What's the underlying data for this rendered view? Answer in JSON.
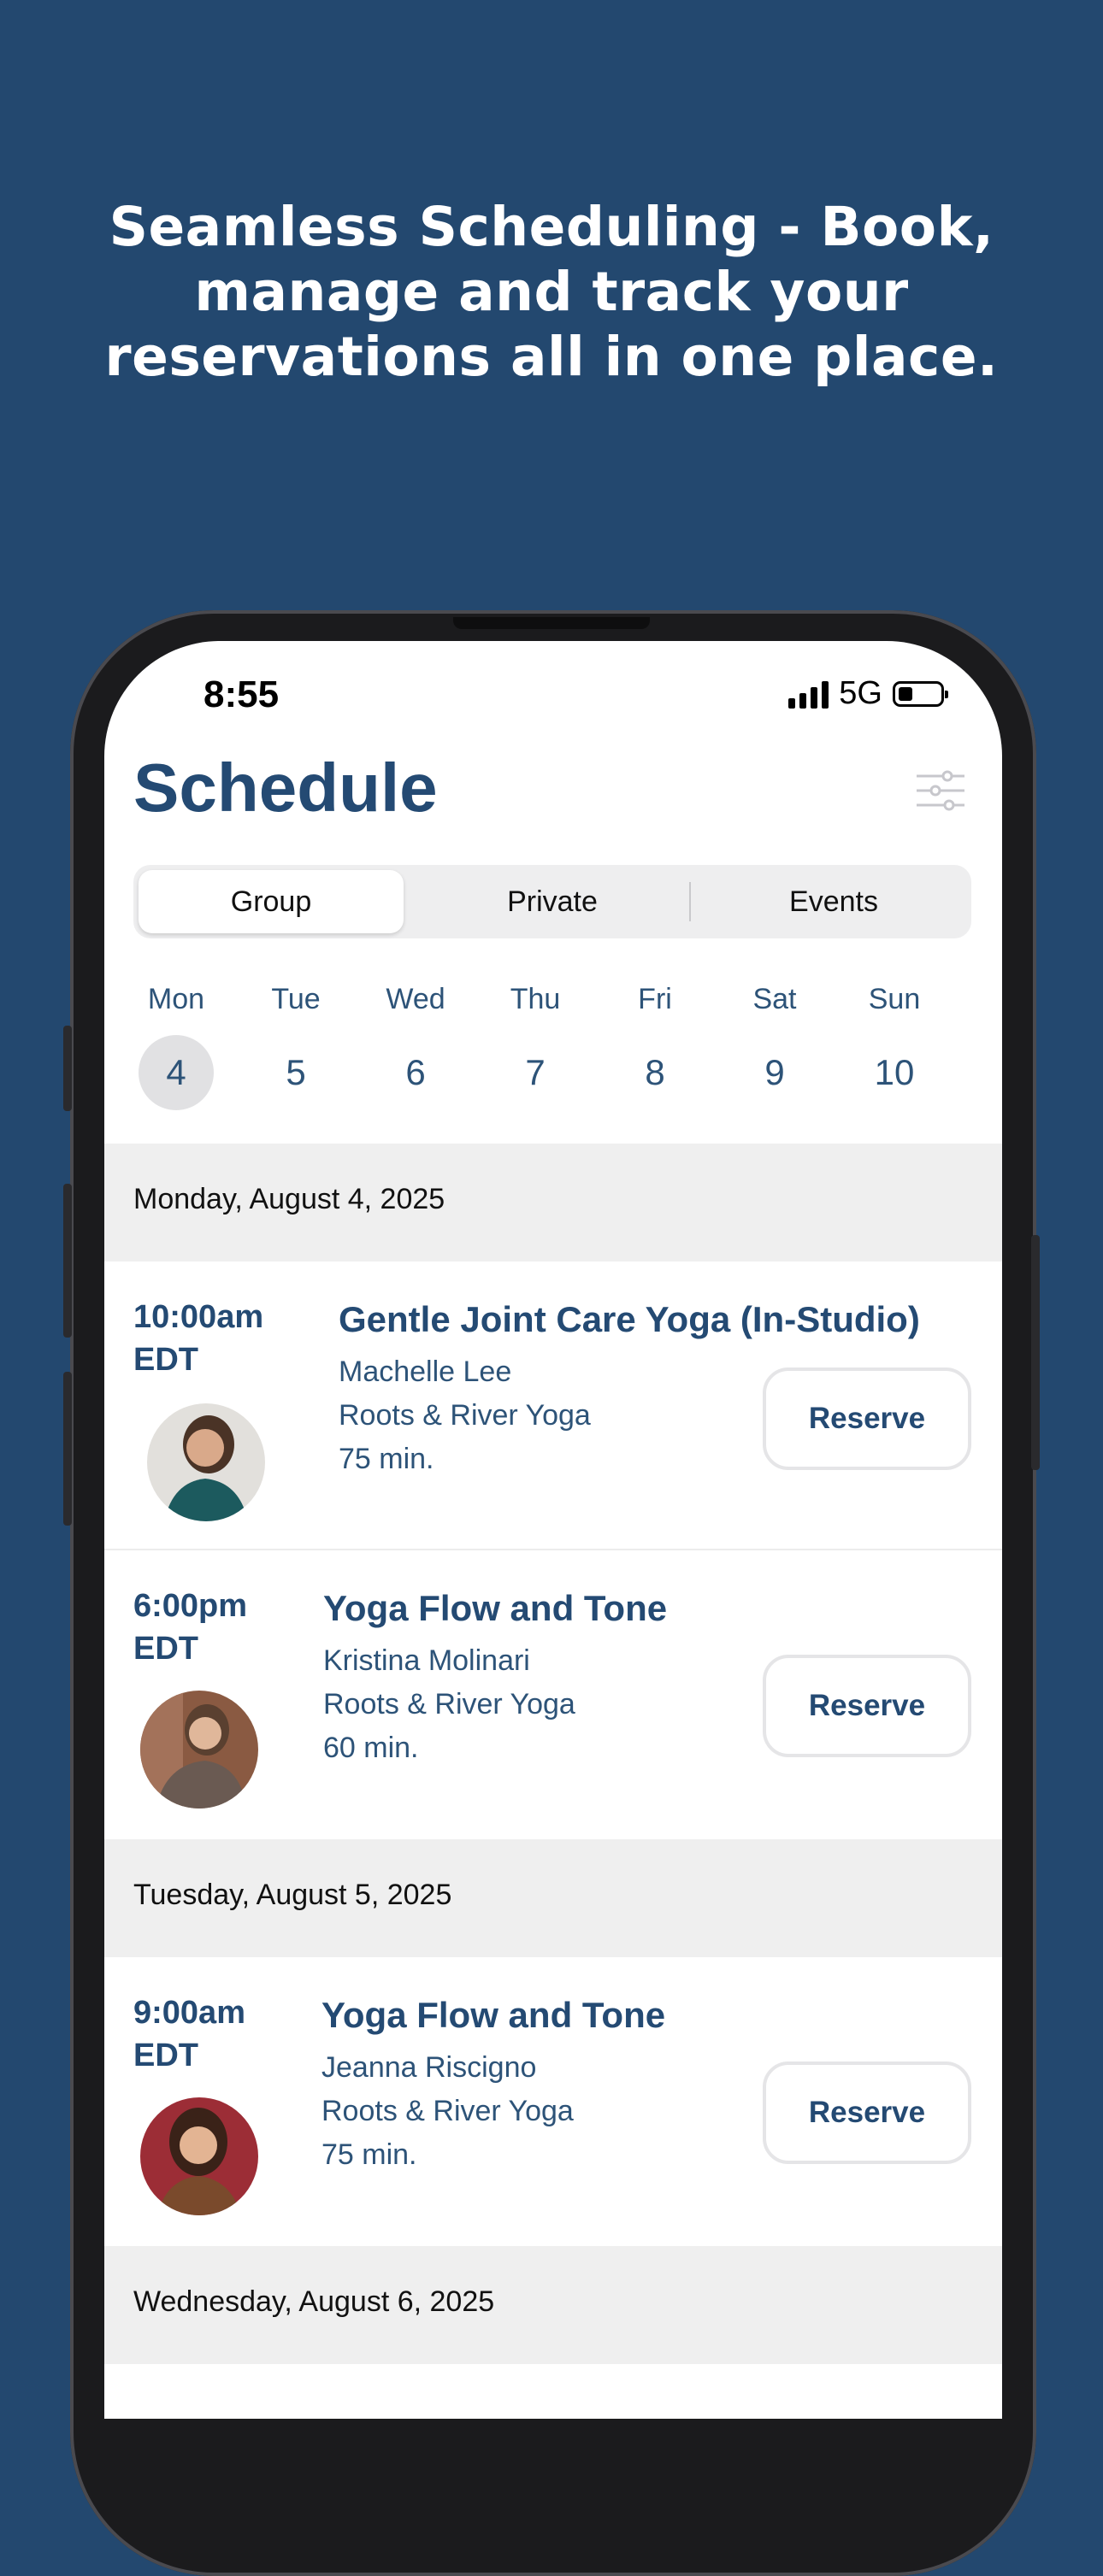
{
  "headline": {
    "line1": "Seamless Scheduling - Book,",
    "line2": "manage and track your",
    "line3": "reservations all in one place."
  },
  "status": {
    "time": "8:55",
    "network": "5G"
  },
  "page_title": "Schedule",
  "tabs": [
    {
      "label": "Group",
      "active": true
    },
    {
      "label": "Private",
      "active": false
    },
    {
      "label": "Events",
      "active": false
    }
  ],
  "week": [
    {
      "day": "Mon",
      "date": "4",
      "selected": true
    },
    {
      "day": "Tue",
      "date": "5",
      "selected": false
    },
    {
      "day": "Wed",
      "date": "6",
      "selected": false
    },
    {
      "day": "Thu",
      "date": "7",
      "selected": false
    },
    {
      "day": "Fri",
      "date": "8",
      "selected": false
    },
    {
      "day": "Sat",
      "date": "9",
      "selected": false
    },
    {
      "day": "Sun",
      "date": "10",
      "selected": false
    }
  ],
  "sections": [
    {
      "date_label": "Monday, August 4, 2025",
      "classes": [
        {
          "time": "10:00am",
          "tz": "EDT",
          "name": "Gentle Joint Care Yoga (In-Studio)",
          "instructor": "Machelle Lee",
          "studio": "Roots & River Yoga",
          "duration": "75 min.",
          "action": "Reserve"
        },
        {
          "time": "6:00pm",
          "tz": "EDT",
          "name": "Yoga Flow and Tone",
          "instructor": "Kristina Molinari",
          "studio": "Roots & River Yoga",
          "duration": "60 min.",
          "action": "Reserve"
        }
      ]
    },
    {
      "date_label": "Tuesday, August 5, 2025",
      "classes": [
        {
          "time": "9:00am",
          "tz": "EDT",
          "name": "Yoga Flow and Tone",
          "instructor": "Jeanna Riscigno",
          "studio": "Roots & River Yoga",
          "duration": "75 min.",
          "action": "Reserve"
        }
      ]
    },
    {
      "date_label": "Wednesday, August 6, 2025",
      "classes": []
    }
  ],
  "colors": {
    "background": "#23486f",
    "accent": "#244a73",
    "section_bg": "#efefef"
  }
}
